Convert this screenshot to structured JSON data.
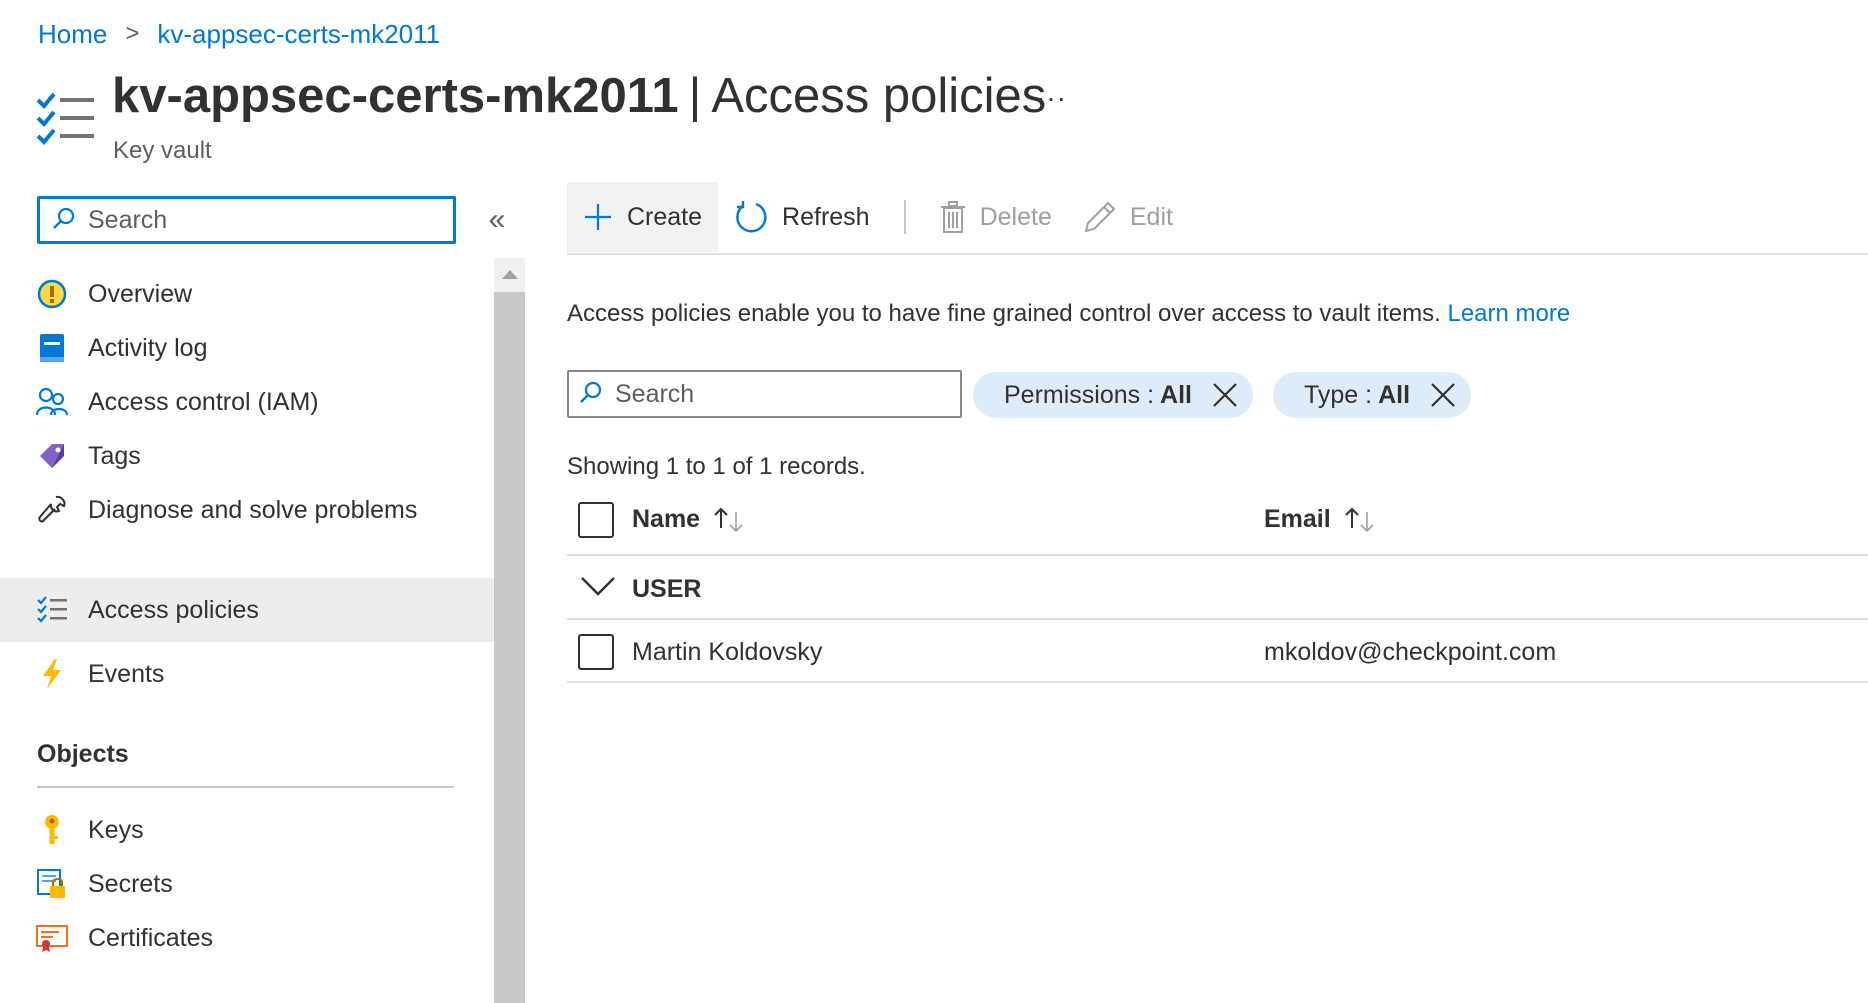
{
  "breadcrumb": {
    "home": "Home",
    "separator": ">",
    "current": "kv-appsec-certs-mk2011"
  },
  "header": {
    "resource": "kv-appsec-certs-mk2011",
    "divider": "|",
    "page": "Access policies",
    "more": "···",
    "subtitle": "Key vault"
  },
  "sidebar": {
    "search_placeholder": "Search",
    "collapse": "«",
    "items": [
      {
        "label": "Overview",
        "icon": "overview-icon"
      },
      {
        "label": "Activity log",
        "icon": "activity-log-icon"
      },
      {
        "label": "Access control (IAM)",
        "icon": "iam-icon"
      },
      {
        "label": "Tags",
        "icon": "tag-icon"
      },
      {
        "label": "Diagnose and solve problems",
        "icon": "wrench-icon"
      },
      {
        "label": "Access policies",
        "icon": "checklist-icon",
        "active": true
      },
      {
        "label": "Events",
        "icon": "lightning-icon"
      }
    ],
    "objects_heading": "Objects",
    "object_items": [
      {
        "label": "Keys",
        "icon": "key-icon"
      },
      {
        "label": "Secrets",
        "icon": "secret-icon"
      },
      {
        "label": "Certificates",
        "icon": "certificate-icon"
      }
    ]
  },
  "toolbar": {
    "create": "Create",
    "refresh": "Refresh",
    "delete": "Delete",
    "edit": "Edit"
  },
  "description": {
    "text": "Access policies enable you to have fine grained control over access to vault items.",
    "link": "Learn more"
  },
  "filters": {
    "search_placeholder": "Search",
    "permissions_label": "Permissions :",
    "permissions_value": "All",
    "type_label": "Type :",
    "type_value": "All"
  },
  "records_text": "Showing 1 to 1 of 1 records.",
  "table": {
    "columns": [
      "Name",
      "Email"
    ],
    "group": "USER",
    "rows": [
      {
        "name": "Martin Koldovsky",
        "email": "mkoldov@checkpoint.com"
      }
    ]
  },
  "colors": {
    "accent": "#0078d4",
    "active_nav": "#ededed",
    "pill": "#deecf9"
  }
}
